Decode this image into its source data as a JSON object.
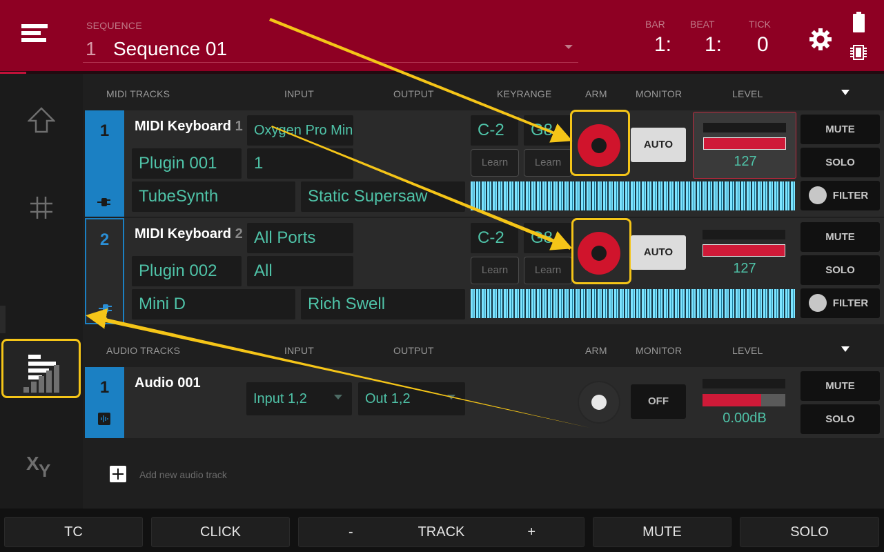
{
  "header": {
    "sequence_label": "SEQUENCE",
    "sequence_number": "1",
    "sequence_name": "Sequence 01",
    "bar_label": "BAR",
    "beat_label": "BEAT",
    "tick_label": "TICK",
    "bar_value": "1:",
    "beat_value": "1:",
    "tick_value": "0"
  },
  "midi_section": {
    "col_tracks": "MIDI TRACKS",
    "col_input": "INPUT",
    "col_output": "OUTPUT",
    "col_keyrange": "KEYRANGE",
    "col_arm": "ARM",
    "col_monitor": "MONITOR",
    "col_level": "LEVEL",
    "tracks": [
      {
        "number": "1",
        "name": "MIDI Keyboard",
        "name_suffix": "1",
        "input": "Oxygen Pro Mini...",
        "plugin": "Plugin 001",
        "channel": "1",
        "instrument": "TubeSynth",
        "preset": "Static Supersaw",
        "key_low": "C-2",
        "key_high": "G8",
        "learn_low": "Learn",
        "learn_high": "Learn",
        "monitor": "AUTO",
        "level": "127",
        "level_fraction": 1.0,
        "mute": "MUTE",
        "solo": "SOLO",
        "filter": "FILTER"
      },
      {
        "number": "2",
        "name": "MIDI Keyboard",
        "name_suffix": "2",
        "input": "All Ports",
        "plugin": "Plugin 002",
        "channel": "All",
        "instrument": "Mini D",
        "preset": "Rich Swell",
        "key_low": "C-2",
        "key_high": "G8",
        "learn_low": "Learn",
        "learn_high": "Learn",
        "monitor": "AUTO",
        "level": "127",
        "level_fraction": 1.0,
        "mute": "MUTE",
        "solo": "SOLO",
        "filter": "FILTER"
      }
    ]
  },
  "audio_section": {
    "col_tracks": "AUDIO TRACKS",
    "col_input": "INPUT",
    "col_output": "OUTPUT",
    "col_arm": "ARM",
    "col_monitor": "MONITOR",
    "col_level": "LEVEL",
    "tracks": [
      {
        "number": "1",
        "name": "Audio 001",
        "input": "Input 1,2",
        "output": "Out 1,2",
        "monitor": "OFF",
        "level": "0.00dB",
        "level_fraction": 0.71,
        "mute": "MUTE",
        "solo": "SOLO"
      }
    ],
    "add_label": "Add new audio track"
  },
  "bottom_bar": {
    "tc": "TC",
    "click": "CLICK",
    "minus": "-",
    "track": "TRACK",
    "plus": "+",
    "mute": "MUTE",
    "solo": "SOLO"
  },
  "colors": {
    "header": "#8e0023",
    "accent_blue": "#1b80c3",
    "value_teal": "#4fc3a8",
    "highlight_yellow": "#f5c518",
    "arm_red": "#d0142c"
  }
}
